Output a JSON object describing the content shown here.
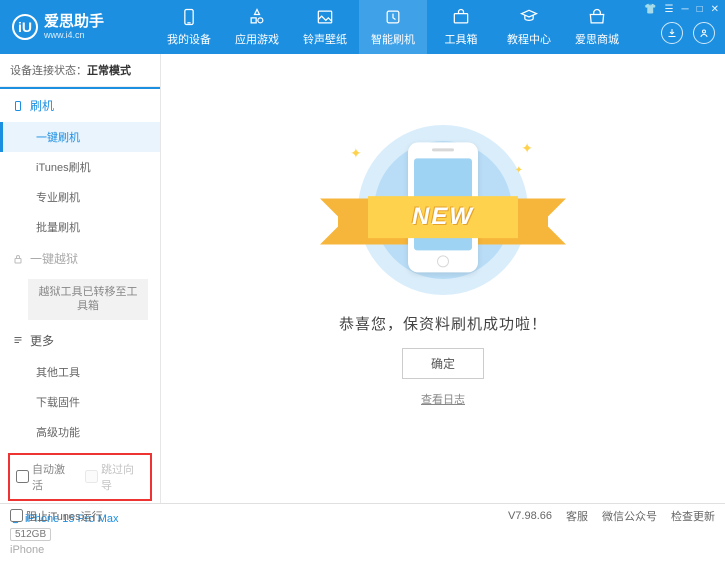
{
  "app": {
    "name": "爱思助手",
    "url": "www.i4.cn",
    "logo_letter": "iU"
  },
  "winbtns": {
    "skin": "▾",
    "tray": "☰",
    "min": "─",
    "max": "□",
    "close": "✕"
  },
  "nav": [
    {
      "label": "我的设备"
    },
    {
      "label": "应用游戏"
    },
    {
      "label": "铃声壁纸"
    },
    {
      "label": "智能刷机"
    },
    {
      "label": "工具箱"
    },
    {
      "label": "教程中心"
    },
    {
      "label": "爱思商城"
    }
  ],
  "status": {
    "prefix": "设备连接状态：",
    "value": "正常模式"
  },
  "sidebar": {
    "flash_head": "刷机",
    "flash_items": [
      "一键刷机",
      "iTunes刷机",
      "专业刷机",
      "批量刷机"
    ],
    "jailbreak_head": "一键越狱",
    "jailbreak_note": "越狱工具已转移至工具箱",
    "more_head": "更多",
    "more_items": [
      "其他工具",
      "下载固件",
      "高级功能"
    ],
    "auto_activate": "自动激活",
    "skip_guide": "跳过向导"
  },
  "device": {
    "name": "iPhone 15 Pro Max",
    "storage": "512GB",
    "type": "iPhone"
  },
  "main": {
    "ribbon": "NEW",
    "message": "恭喜您，保资料刷机成功啦！",
    "ok": "确定",
    "view_log": "查看日志"
  },
  "footer": {
    "block_itunes": "阻止iTunes运行",
    "version": "V7.98.66",
    "links": [
      "客服",
      "微信公众号",
      "检查更新"
    ]
  }
}
